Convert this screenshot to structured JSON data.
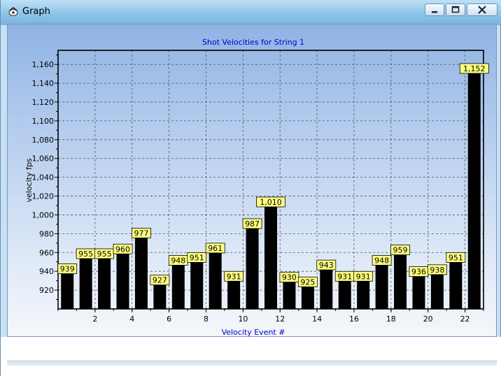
{
  "window": {
    "title": "Graph",
    "icon": "graph-app-icon",
    "buttons": [
      "minimize-icon",
      "maximize-icon",
      "close-icon"
    ]
  },
  "chart_data": {
    "type": "bar",
    "title": "Shot Velocities for String 1",
    "xlabel": "Velocity Event #",
    "ylabel": "velocity fps",
    "x": [
      1,
      2,
      3,
      4,
      5,
      6,
      7,
      8,
      9,
      10,
      11,
      12,
      13,
      14,
      15,
      16,
      17,
      18,
      19,
      20,
      21,
      22,
      23
    ],
    "values": [
      939,
      955,
      955,
      960,
      977,
      927,
      948,
      951,
      961,
      931,
      987,
      1010,
      930,
      925,
      943,
      931,
      931,
      948,
      959,
      936,
      938,
      951,
      1152
    ],
    "data_labels": [
      "939",
      "955",
      "955",
      "960",
      "977",
      "927",
      "948",
      "951",
      "961",
      "931",
      "987",
      "1,010",
      "930",
      "925",
      "943",
      "931",
      "931",
      "948",
      "959",
      "936",
      "938",
      "951",
      "1,152"
    ],
    "x_ticks": [
      "2",
      "4",
      "6",
      "8",
      "10",
      "12",
      "14",
      "16",
      "18",
      "20",
      "22"
    ],
    "y_ticks": [
      "920",
      "940",
      "960",
      "980",
      "1,000",
      "1,020",
      "1,040",
      "1,060",
      "1,080",
      "1,100",
      "1,120",
      "1,140",
      "1,160"
    ],
    "ylim": [
      900,
      1175
    ],
    "grid": true,
    "colors": {
      "bar": "#000000",
      "label_bg": "#ffff80",
      "title": "#0000cc",
      "xlabel": "#0000cc"
    }
  }
}
